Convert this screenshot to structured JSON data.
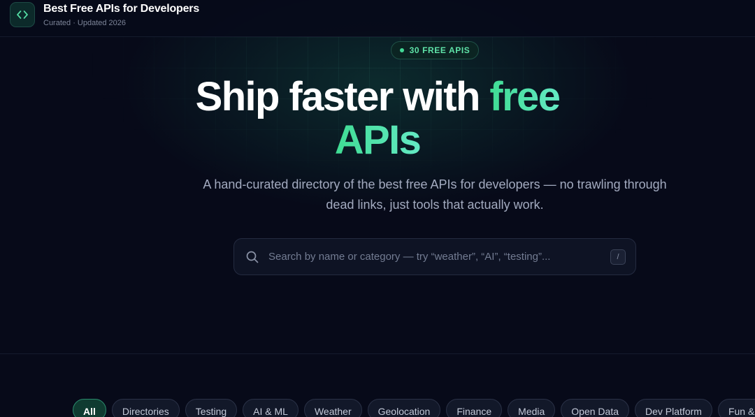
{
  "header": {
    "brand_title": "Best Free APIs for Developers",
    "brand_subtitle": "Curated · Updated 2026",
    "logo_icon": "code-brackets-icon"
  },
  "hero": {
    "badge": "30 FREE APIS",
    "title_plain": "Ship faster with ",
    "title_accent_1": "free",
    "title_accent_2": "APIs",
    "description": "A hand-curated directory of the best free APIs for developers — no trawling through dead links, just tools that actually work."
  },
  "search": {
    "placeholder": "Search by name or category — try “weather”, “AI”, “testing”...",
    "value": "",
    "shortcut": "/",
    "icon": "search-icon"
  },
  "filters": {
    "active": "All",
    "chips": [
      "All",
      "Directories",
      "Testing",
      "AI & ML",
      "Weather",
      "Geolocation",
      "Finance",
      "Media",
      "Open Data",
      "Dev Platform",
      "Fun & F"
    ]
  },
  "colors": {
    "background": "#070a19",
    "accent": "#3fdc93",
    "accent_alt": "#64e9c4",
    "badge_text": "#5fe3a8"
  }
}
